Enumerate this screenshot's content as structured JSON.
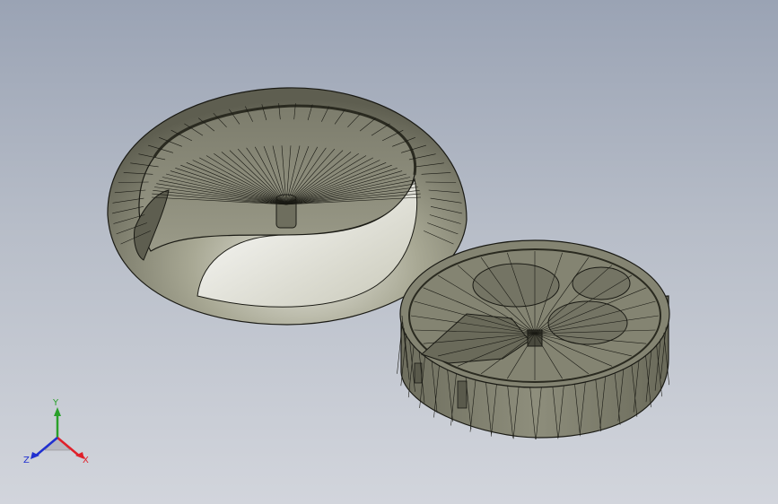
{
  "viewport": {
    "background_top": "#9aa3b4",
    "background_bottom": "#d2d5dc",
    "mesh_color": "#1a1a14",
    "surface_color": "#8a8a78"
  },
  "triad": {
    "x_label": "X",
    "y_label": "Y",
    "z_label": "Z",
    "x_color": "#e0202a",
    "y_color": "#2aa02a",
    "z_color": "#2030d0"
  }
}
